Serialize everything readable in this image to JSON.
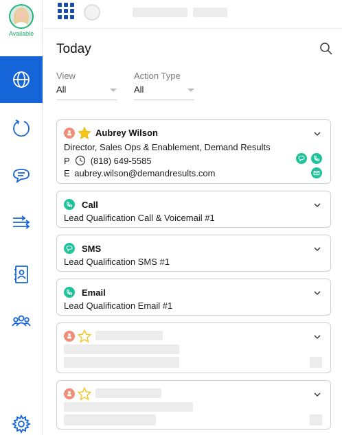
{
  "sidebar": {
    "status": "Available",
    "nav": [
      {
        "name": "globe-icon",
        "active": true
      },
      {
        "name": "refresh-icon",
        "active": false
      },
      {
        "name": "chat-icon",
        "active": false
      },
      {
        "name": "arrows-icon",
        "active": false
      },
      {
        "name": "contact-card-icon",
        "active": false
      },
      {
        "name": "people-icon",
        "active": false
      },
      {
        "name": "settings-gear-icon",
        "active": false
      }
    ]
  },
  "page": {
    "title": "Today"
  },
  "filters": {
    "view": {
      "label": "View",
      "value": "All"
    },
    "action_type": {
      "label": "Action Type",
      "value": "All"
    }
  },
  "contact_card": {
    "name": "Aubrey Wilson",
    "title": "Director, Sales Ops & Enablement, Demand Results",
    "phone_prefix": "P",
    "phone": "(818) 649-5585",
    "email_prefix": "E",
    "email": "aubrey.wilson@demandresults.com"
  },
  "tasks": [
    {
      "type": "Call",
      "description": "Lead Qualification Call & Voicemail #1",
      "icon": "phone-icon"
    },
    {
      "type": "SMS",
      "description": "Lead Qualification SMS #1",
      "icon": "sms-icon"
    },
    {
      "type": "Email",
      "description": "Lead Qualification Email #1",
      "icon": "phone-icon"
    }
  ],
  "colors": {
    "accent": "#1565d8",
    "available": "#1aa86b",
    "action_green": "#1ec39a",
    "priority_orange": "#ef8d76",
    "star_yellow": "#f5c518"
  }
}
